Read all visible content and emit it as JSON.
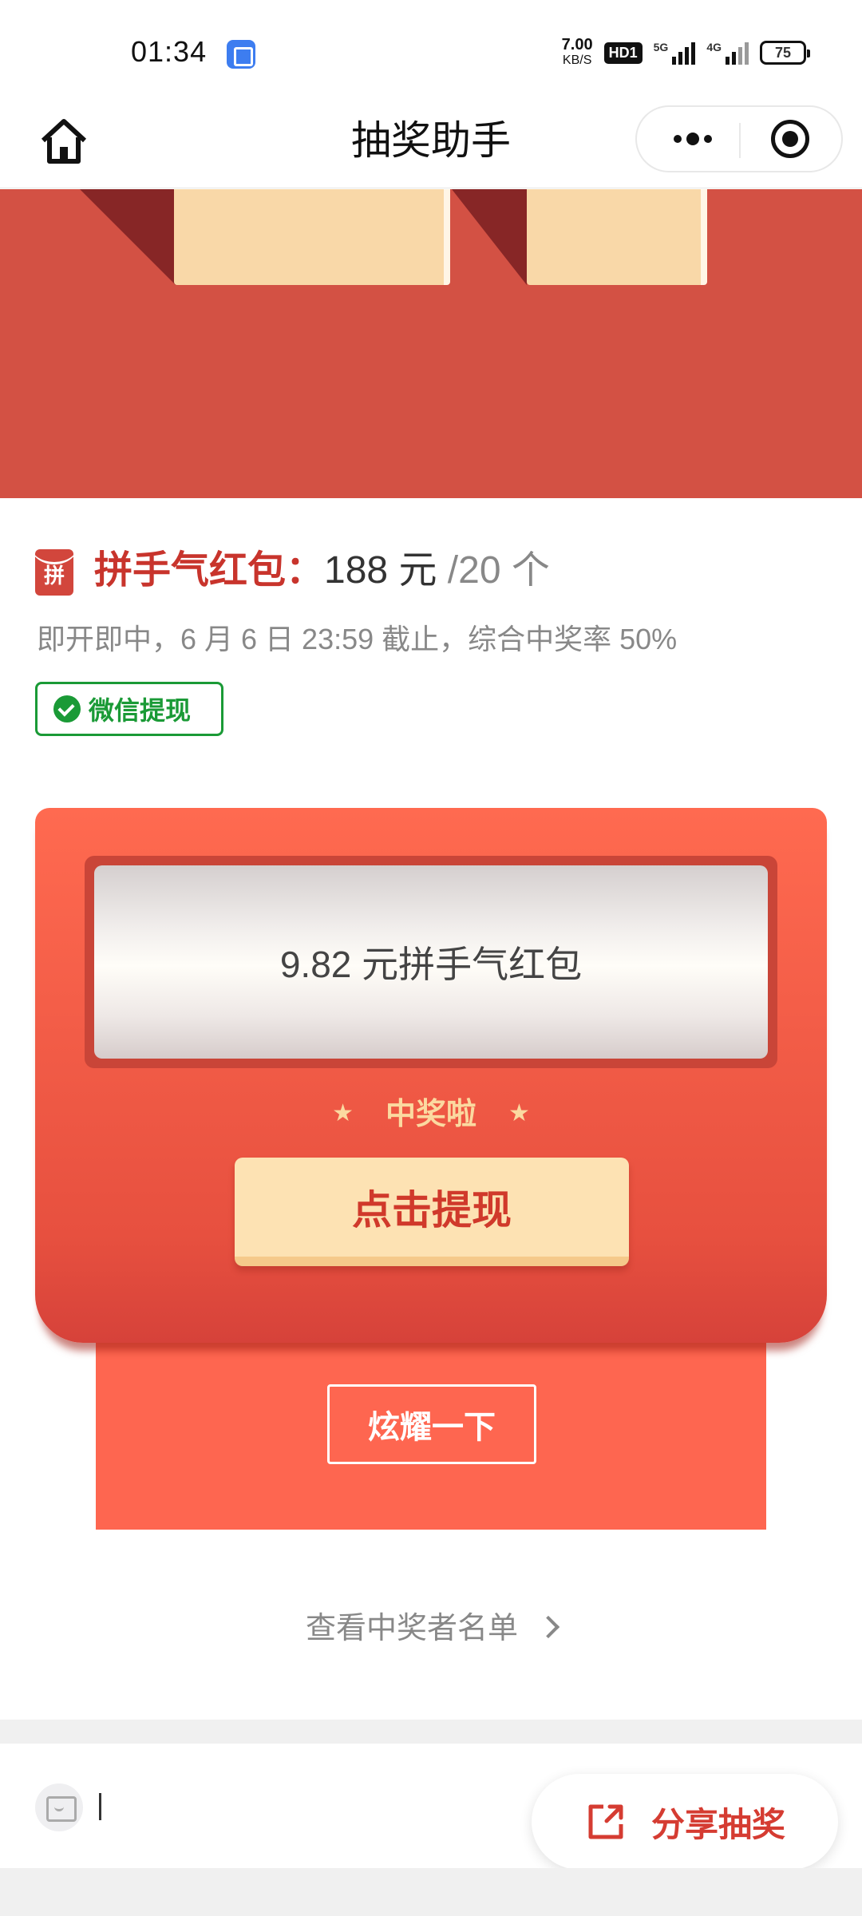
{
  "status_bar": {
    "time": "01:34",
    "net_speed": "7.00",
    "net_speed_unit": "KB/S",
    "hd": "HD1",
    "signal1": "5G",
    "signal2": "4G",
    "battery": "75"
  },
  "nav": {
    "title": "抽奖助手"
  },
  "prize": {
    "icon_char": "拼",
    "name": "拼手气红包：",
    "amount": "188 元",
    "count": " /20 个",
    "description": "即开即中，6 月 6 日 23:59 截止，综合中奖率 50%",
    "withdraw_tag": "微信提现"
  },
  "envelope": {
    "ticket_text": "9.82 元拼手气红包",
    "win_text": "中奖啦",
    "star": "★",
    "withdraw_button": "点击提现",
    "show_off_button": "炫耀一下"
  },
  "winners_link": "查看中奖者名单",
  "bottom": {
    "share_button": "分享抽奖"
  },
  "colors": {
    "brand_red": "#d35144",
    "envelope_red": "#fe6650",
    "gold": "#fde2b3",
    "wechat_green": "#1a9a36"
  }
}
